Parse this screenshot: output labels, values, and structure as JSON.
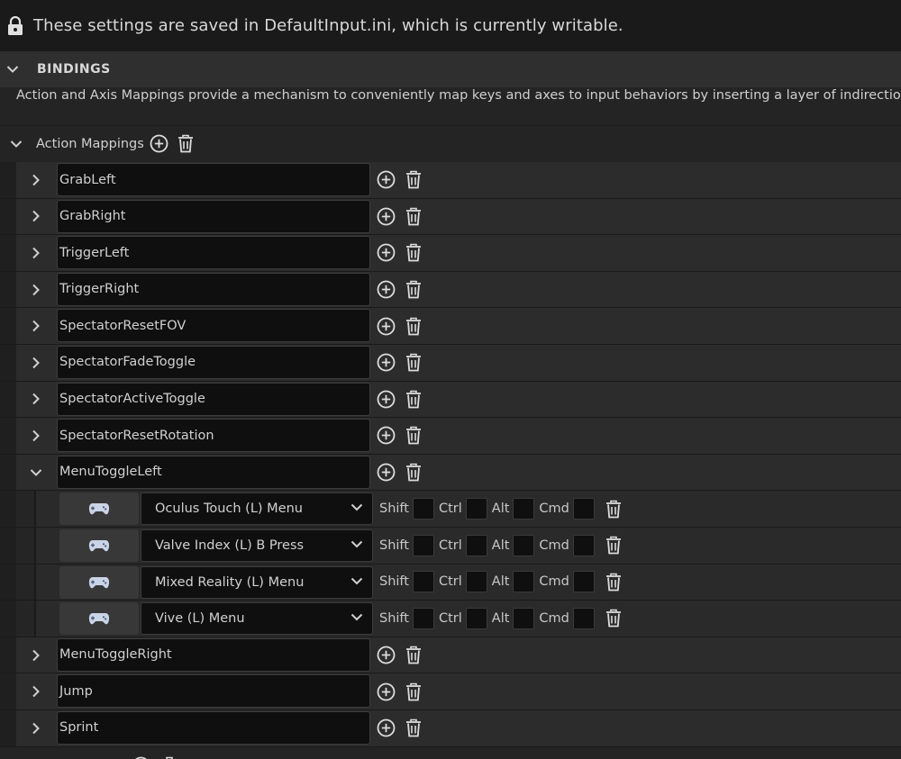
{
  "info_bar": {
    "text": "These settings are saved in DefaultInput.ini, which is currently writable.",
    "icon": "lock-icon"
  },
  "bindings": {
    "title": "BINDINGS",
    "description": "Action and Axis Mappings provide a mechanism to conveniently map keys and axes to input behaviors by inserting a layer of indirection between the"
  },
  "action_mappings": {
    "label": "Action Mappings",
    "items": [
      {
        "name": "GrabLeft",
        "expanded": false
      },
      {
        "name": "GrabRight",
        "expanded": false
      },
      {
        "name": "TriggerLeft",
        "expanded": false
      },
      {
        "name": "TriggerRight",
        "expanded": false
      },
      {
        "name": "SpectatorResetFOV",
        "expanded": false
      },
      {
        "name": "SpectatorFadeToggle",
        "expanded": false
      },
      {
        "name": "SpectatorActiveToggle",
        "expanded": false
      },
      {
        "name": "SpectatorResetRotation",
        "expanded": false
      },
      {
        "name": "MenuToggleLeft",
        "expanded": true
      },
      {
        "name": "MenuToggleRight",
        "expanded": false
      },
      {
        "name": "Jump",
        "expanded": false
      },
      {
        "name": "Sprint",
        "expanded": false
      }
    ],
    "menu_toggle_left_keys": [
      {
        "key": "Oculus Touch (L) Menu"
      },
      {
        "key": "Valve Index (L) B Press"
      },
      {
        "key": "Mixed Reality (L) Menu"
      },
      {
        "key": "Vive (L) Menu"
      }
    ]
  },
  "modifiers": {
    "shift": "Shift",
    "ctrl": "Ctrl",
    "alt": "Alt",
    "cmd": "Cmd"
  },
  "colors": {
    "background": "#242424",
    "info_bar": "#1a1a1a",
    "header": "#2f2f2f",
    "input_field": "#0f0f0f",
    "text": "#d0d0d0"
  }
}
